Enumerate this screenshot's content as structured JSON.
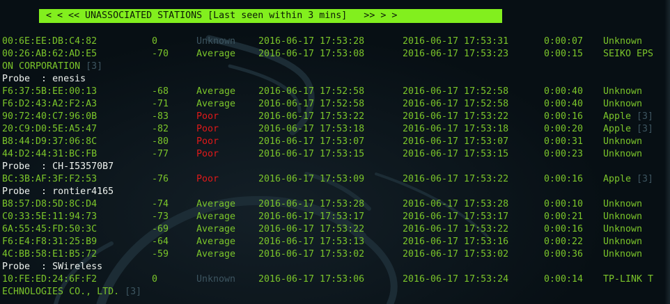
{
  "banner": {
    "text": "< < << UNASSOCIATED STATIONS [Last seen within 3 mins]   >> > >"
  },
  "rows": [
    {
      "kind": "station",
      "mac": "00:6E:EE:DB:C4:82",
      "power": "0",
      "quality": "Unknown",
      "quality_style": "dim",
      "first_seen": "2016-06-17 17:53:28",
      "last_seen": "2016-06-17 17:53:31",
      "duration": "0:00:07",
      "vendor": "Unknown",
      "vendor_suffix": ""
    },
    {
      "kind": "station",
      "mac": "00:26:AB:62:AD:E5",
      "power": "-70",
      "quality": "Average",
      "quality_style": "green",
      "first_seen": "2016-06-17 17:53:08",
      "last_seen": "2016-06-17 17:53:23",
      "duration": "0:00:15",
      "vendor": "SEIKO EPS",
      "vendor_suffix": ""
    },
    {
      "kind": "wrap",
      "text": "ON CORPORATION",
      "suffix": " [3]"
    },
    {
      "kind": "probe",
      "label": "Probe  : ",
      "value": "enesis"
    },
    {
      "kind": "station",
      "mac": "F6:37:5B:EE:00:13",
      "power": "-68",
      "quality": "Average",
      "quality_style": "green",
      "first_seen": "2016-06-17 17:52:58",
      "last_seen": "2016-06-17 17:52:58",
      "duration": "0:00:40",
      "vendor": "Unknown",
      "vendor_suffix": ""
    },
    {
      "kind": "station",
      "mac": "F6:D2:43:A2:F2:A3",
      "power": "-71",
      "quality": "Average",
      "quality_style": "green",
      "first_seen": "2016-06-17 17:52:58",
      "last_seen": "2016-06-17 17:52:58",
      "duration": "0:00:40",
      "vendor": "Unknown",
      "vendor_suffix": ""
    },
    {
      "kind": "station",
      "mac": "90:72:40:C7:96:0B",
      "power": "-83",
      "quality": "Poor",
      "quality_style": "poor",
      "first_seen": "2016-06-17 17:53:22",
      "last_seen": "2016-06-17 17:53:22",
      "duration": "0:00:16",
      "vendor": "Apple",
      "vendor_suffix": " [3]"
    },
    {
      "kind": "station",
      "mac": "20:C9:D0:5E:A5:47",
      "power": "-82",
      "quality": "Poor",
      "quality_style": "poor",
      "first_seen": "2016-06-17 17:53:18",
      "last_seen": "2016-06-17 17:53:18",
      "duration": "0:00:20",
      "vendor": "Apple",
      "vendor_suffix": " [3]"
    },
    {
      "kind": "station",
      "mac": "B8:44:D9:37:06:8C",
      "power": "-80",
      "quality": "Poor",
      "quality_style": "poor",
      "first_seen": "2016-06-17 17:53:07",
      "last_seen": "2016-06-17 17:53:07",
      "duration": "0:00:31",
      "vendor": "Unknown",
      "vendor_suffix": ""
    },
    {
      "kind": "station",
      "mac": "44:D2:44:31:BC:FB",
      "power": "-77",
      "quality": "Poor",
      "quality_style": "poor",
      "first_seen": "2016-06-17 17:53:15",
      "last_seen": "2016-06-17 17:53:15",
      "duration": "0:00:23",
      "vendor": "Unknown",
      "vendor_suffix": ""
    },
    {
      "kind": "probe",
      "label": "Probe  : ",
      "value": "CH-I53570B7"
    },
    {
      "kind": "station",
      "mac": "BC:3B:AF:3F:F2:53",
      "power": "-76",
      "quality": "Poor",
      "quality_style": "poor",
      "first_seen": "2016-06-17 17:53:09",
      "last_seen": "2016-06-17 17:53:22",
      "duration": "0:00:16",
      "vendor": "Apple",
      "vendor_suffix": " [3]"
    },
    {
      "kind": "probe",
      "label": "Probe  : ",
      "value": "rontier4165"
    },
    {
      "kind": "station",
      "mac": "B8:57:D8:5D:8C:D4",
      "power": "-74",
      "quality": "Average",
      "quality_style": "green",
      "first_seen": "2016-06-17 17:53:28",
      "last_seen": "2016-06-17 17:53:28",
      "duration": "0:00:10",
      "vendor": "Unknown",
      "vendor_suffix": ""
    },
    {
      "kind": "station",
      "mac": "C0:33:5E:11:94:73",
      "power": "-73",
      "quality": "Average",
      "quality_style": "green",
      "first_seen": "2016-06-17 17:53:17",
      "last_seen": "2016-06-17 17:53:17",
      "duration": "0:00:21",
      "vendor": "Unknown",
      "vendor_suffix": ""
    },
    {
      "kind": "station",
      "mac": "6A:55:45:FD:50:3C",
      "power": "-69",
      "quality": "Average",
      "quality_style": "green",
      "first_seen": "2016-06-17 17:53:22",
      "last_seen": "2016-06-17 17:53:22",
      "duration": "0:00:16",
      "vendor": "Unknown",
      "vendor_suffix": ""
    },
    {
      "kind": "station",
      "mac": "F6:E4:F8:31:25:B9",
      "power": "-64",
      "quality": "Average",
      "quality_style": "green",
      "first_seen": "2016-06-17 17:53:13",
      "last_seen": "2016-06-17 17:53:16",
      "duration": "0:00:22",
      "vendor": "Unknown",
      "vendor_suffix": ""
    },
    {
      "kind": "station",
      "mac": "4C:BB:58:E1:B5:72",
      "power": "-59",
      "quality": "Average",
      "quality_style": "green",
      "first_seen": "2016-06-17 17:53:02",
      "last_seen": "2016-06-17 17:53:02",
      "duration": "0:00:36",
      "vendor": "Unknown",
      "vendor_suffix": ""
    },
    {
      "kind": "probe",
      "label": "Probe  : ",
      "value": "SWireless"
    },
    {
      "kind": "station",
      "mac": "10:FE:ED:24:6F:F2",
      "power": "0",
      "quality": "Unknown",
      "quality_style": "dim",
      "first_seen": "2016-06-17 17:53:06",
      "last_seen": "2016-06-17 17:53:24",
      "duration": "0:00:14",
      "vendor": "TP-LINK T",
      "vendor_suffix": ""
    },
    {
      "kind": "wrap",
      "text": "ECHNOLOGIES CO., LTD.",
      "suffix": " [3]"
    }
  ],
  "colors": {
    "banner_bg": "#82ef1e",
    "text_green": "#7bc52a",
    "text_white": "#eef2ee",
    "text_dim": "#3d5560",
    "text_poor": "#e01919",
    "background": "#070f14"
  }
}
